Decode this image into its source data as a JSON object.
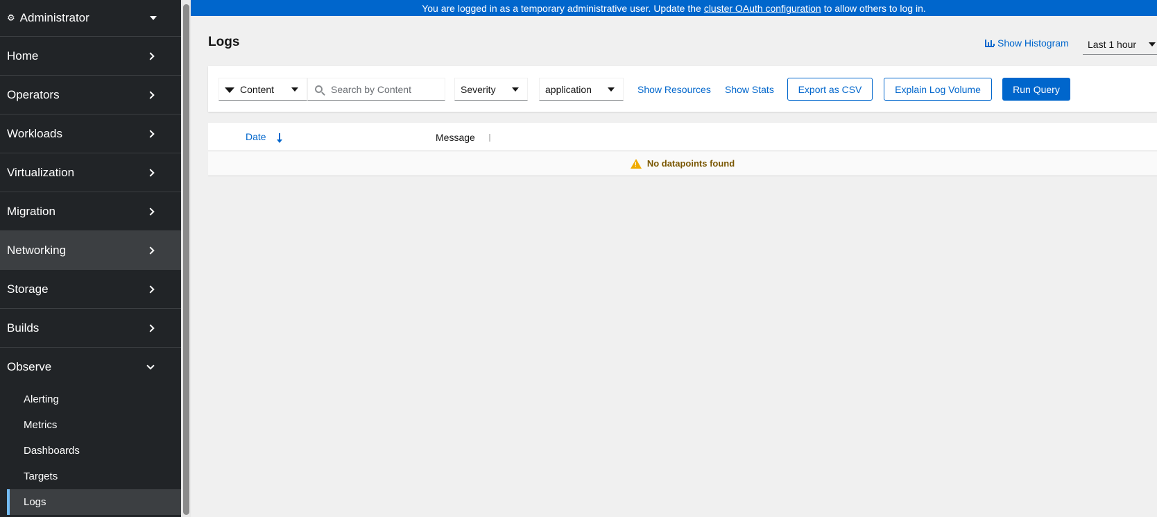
{
  "sidebar": {
    "perspective": "Administrator",
    "items": [
      {
        "label": "Home"
      },
      {
        "label": "Operators"
      },
      {
        "label": "Workloads"
      },
      {
        "label": "Virtualization"
      },
      {
        "label": "Migration"
      },
      {
        "label": "Networking"
      },
      {
        "label": "Storage"
      },
      {
        "label": "Builds"
      },
      {
        "label": "Observe"
      }
    ],
    "observe_children": [
      "Alerting",
      "Metrics",
      "Dashboards",
      "Targets",
      "Logs"
    ],
    "active_item": "Logs"
  },
  "banner": {
    "text_before": "You are logged in as a temporary administrative user. Update the",
    "link": "cluster OAuth configuration",
    "text_after": "to allow others to log in."
  },
  "page": {
    "title": "Logs",
    "show_histogram": "Show Histogram",
    "time_range": "Last 1 hour"
  },
  "toolbar": {
    "filter_attribute": "Content",
    "search_placeholder": "Search by Content",
    "severity": "Severity",
    "tenant": "application",
    "show_resources": "Show Resources",
    "show_stats": "Show Stats",
    "export_csv": "Export as CSV",
    "explain_volume": "Explain Log Volume",
    "run_query": "Run Query"
  },
  "table": {
    "columns": [
      "Date",
      "Message"
    ],
    "empty_message": "No datapoints found"
  },
  "colors": {
    "primary": "#0066cc",
    "sidebar_bg": "#212427",
    "warning": "#f0ab00"
  },
  "icons": {
    "perspective": "cogs-icon",
    "histogram": "bar-chart-icon",
    "filter": "filter-icon",
    "search": "search-icon",
    "warning": "warning-triangle-icon"
  }
}
